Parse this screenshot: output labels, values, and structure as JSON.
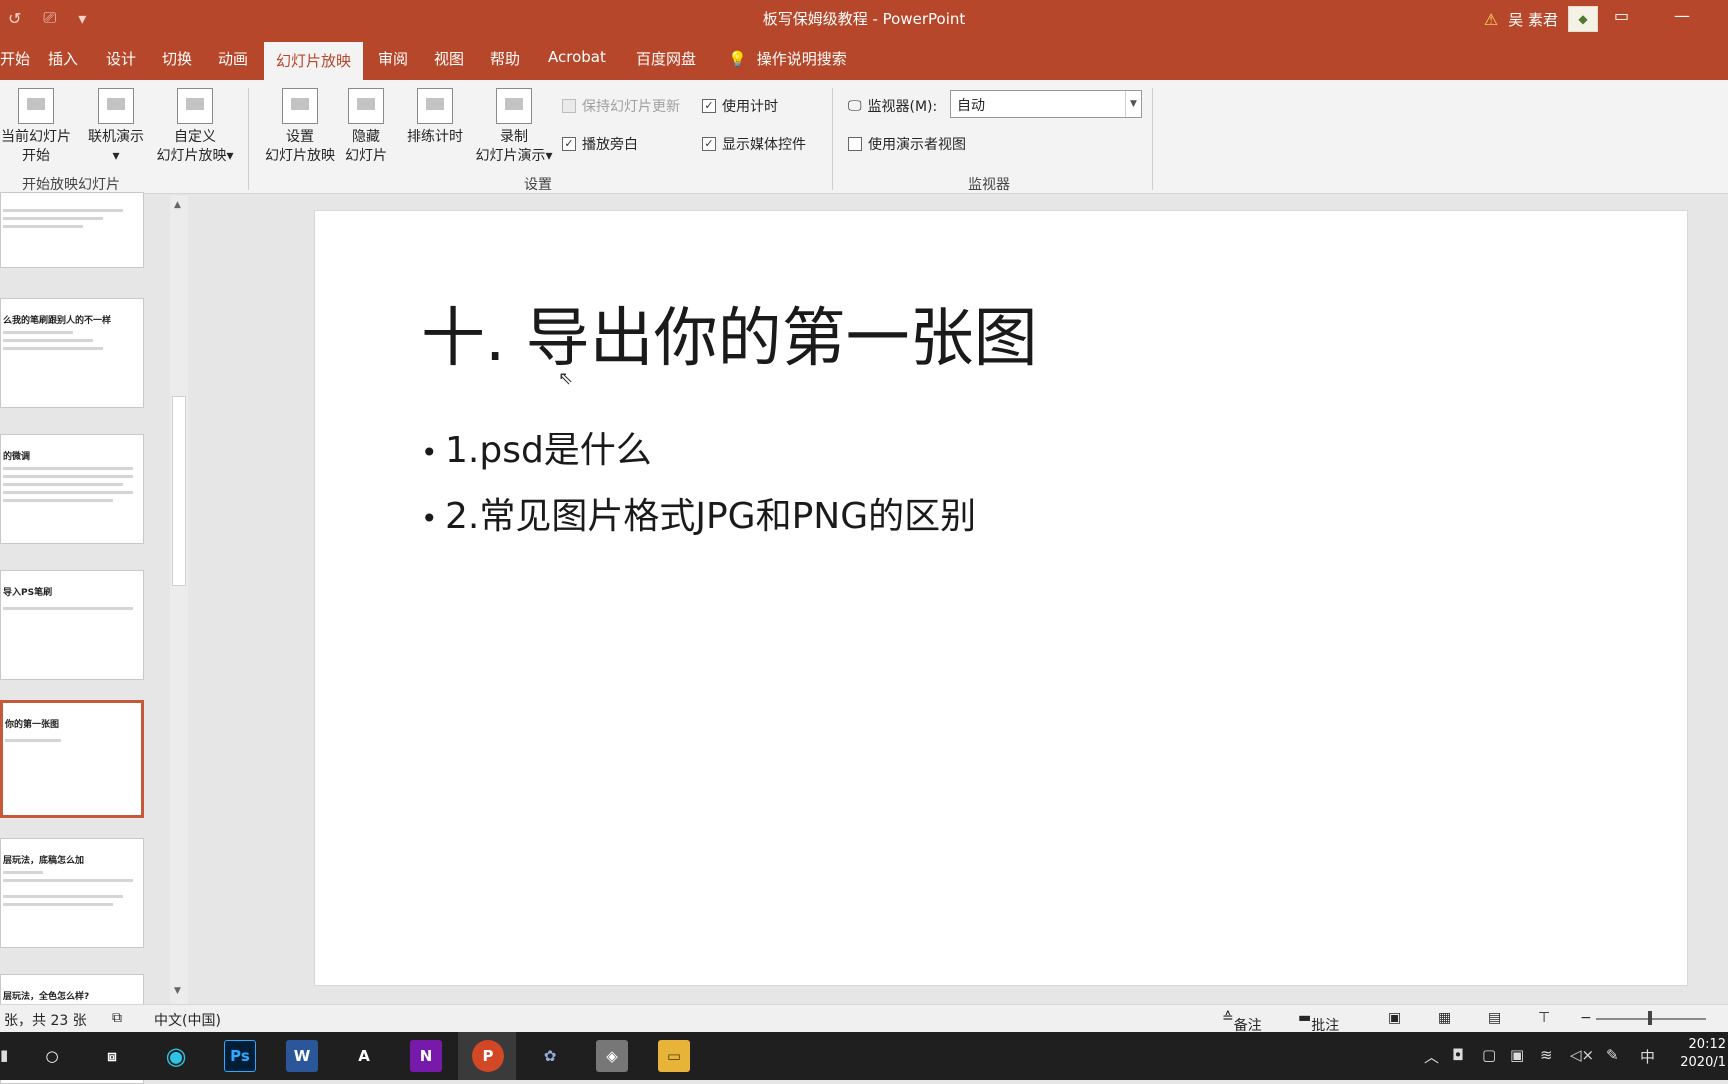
{
  "window": {
    "title": "板写保姆级教程 - PowerPoint",
    "user_name": "吴 素君"
  },
  "tabs": [
    "开始",
    "插入",
    "设计",
    "切换",
    "动画",
    "幻灯片放映",
    "审阅",
    "视图",
    "帮助",
    "Acrobat",
    "百度网盘"
  ],
  "active_tab": "幻灯片放映",
  "tell_me": "操作说明搜索",
  "ribbon": {
    "start_group": {
      "from_current_line1": "当前幻灯片",
      "from_current_line2": "开始",
      "online_present": "联机演示",
      "custom_line1": "自定义",
      "custom_line2": "幻灯片放映",
      "label": "开始放映幻灯片"
    },
    "setup_group": {
      "setup_line1": "设置",
      "setup_line2": "幻灯片放映",
      "hide_line1": "隐藏",
      "hide_line2": "幻灯片",
      "rehearse": "排练计时",
      "record_line1": "录制",
      "record_line2": "幻灯片演示",
      "keep_updated": "保持幻灯片更新",
      "play_narration": "播放旁白",
      "use_timings": "使用计时",
      "show_media": "显示媒体控件",
      "label": "设置"
    },
    "monitor_group": {
      "monitor_label": "监视器(M):",
      "monitor_value": "自动",
      "presenter_view": "使用演示者视图",
      "label": "监视器"
    }
  },
  "thumbnails": [
    {
      "title": ""
    },
    {
      "title": "么我的笔刷跟别人的不一样"
    },
    {
      "title": "的微调"
    },
    {
      "title": "导入PS笔刷"
    },
    {
      "title": "你的第一张图"
    },
    {
      "title": "层玩法，底稿怎么加"
    },
    {
      "title": "层玩法，全色怎么样?"
    }
  ],
  "slide": {
    "title": "十. 导出你的第一张图",
    "bullets": [
      "1.psd是什么",
      "2.常见图片格式JPG和PNG的区别"
    ]
  },
  "status": {
    "slide_count": "张，共 23 张",
    "language": "中文(中国)",
    "notes": "备注",
    "comments": "批注"
  },
  "taskbar": {
    "lang_indicator": "中",
    "time": "20:12",
    "date": "2020/1"
  },
  "colors": {
    "accent": "#b7472a",
    "selected_thumb_border": "#c55a3b"
  }
}
